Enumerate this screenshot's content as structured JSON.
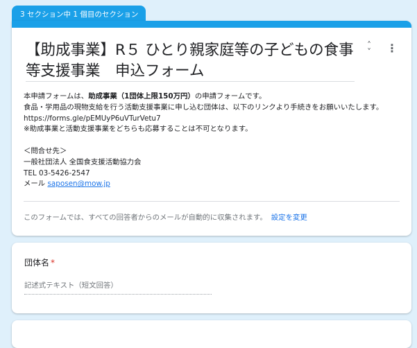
{
  "section_indicator": "3 セクション中 1 個目のセクション",
  "form": {
    "title": "【助成事業】R５ ひとり親家庭等の子どもの食事等支援事業　申込フォーム",
    "collapse_icon": "collapse-icon",
    "more_icon": "more-vert-icon",
    "description": {
      "line1_prefix": "本申請フォームは、",
      "line1_bold": "助成事業（1団体上限150万円）",
      "line1_suffix": "の申請フォームです。",
      "line2": "食品・学用品の現物支給を行う活動支援事業に申し込む団体は、以下のリンクより手続きをお願いいたします。",
      "link_url": "https://forms.gle/pEMUyP6uVTurVetu7",
      "note": "※助成事業と活動支援事業をどちらも応募することは不可となります。",
      "contact_heading": "＜問合せ先＞",
      "org": "一般社団法人 全国食支援活動協力会",
      "tel": "TEL 03-5426-2547",
      "mail_label": "メール ",
      "mail_address": "saposen@mow.jp"
    },
    "email_notice": "このフォームでは、すべての回答者からのメールが自動的に収集されます。",
    "change_settings": "設定を変更"
  },
  "question": {
    "title": "団体名",
    "required_mark": "*",
    "placeholder": "記述式テキスト（短文回答）"
  },
  "colors": {
    "accent": "#1aa0e8",
    "background": "#dff0fb",
    "link": "#1a73e8",
    "required": "#d93025"
  }
}
